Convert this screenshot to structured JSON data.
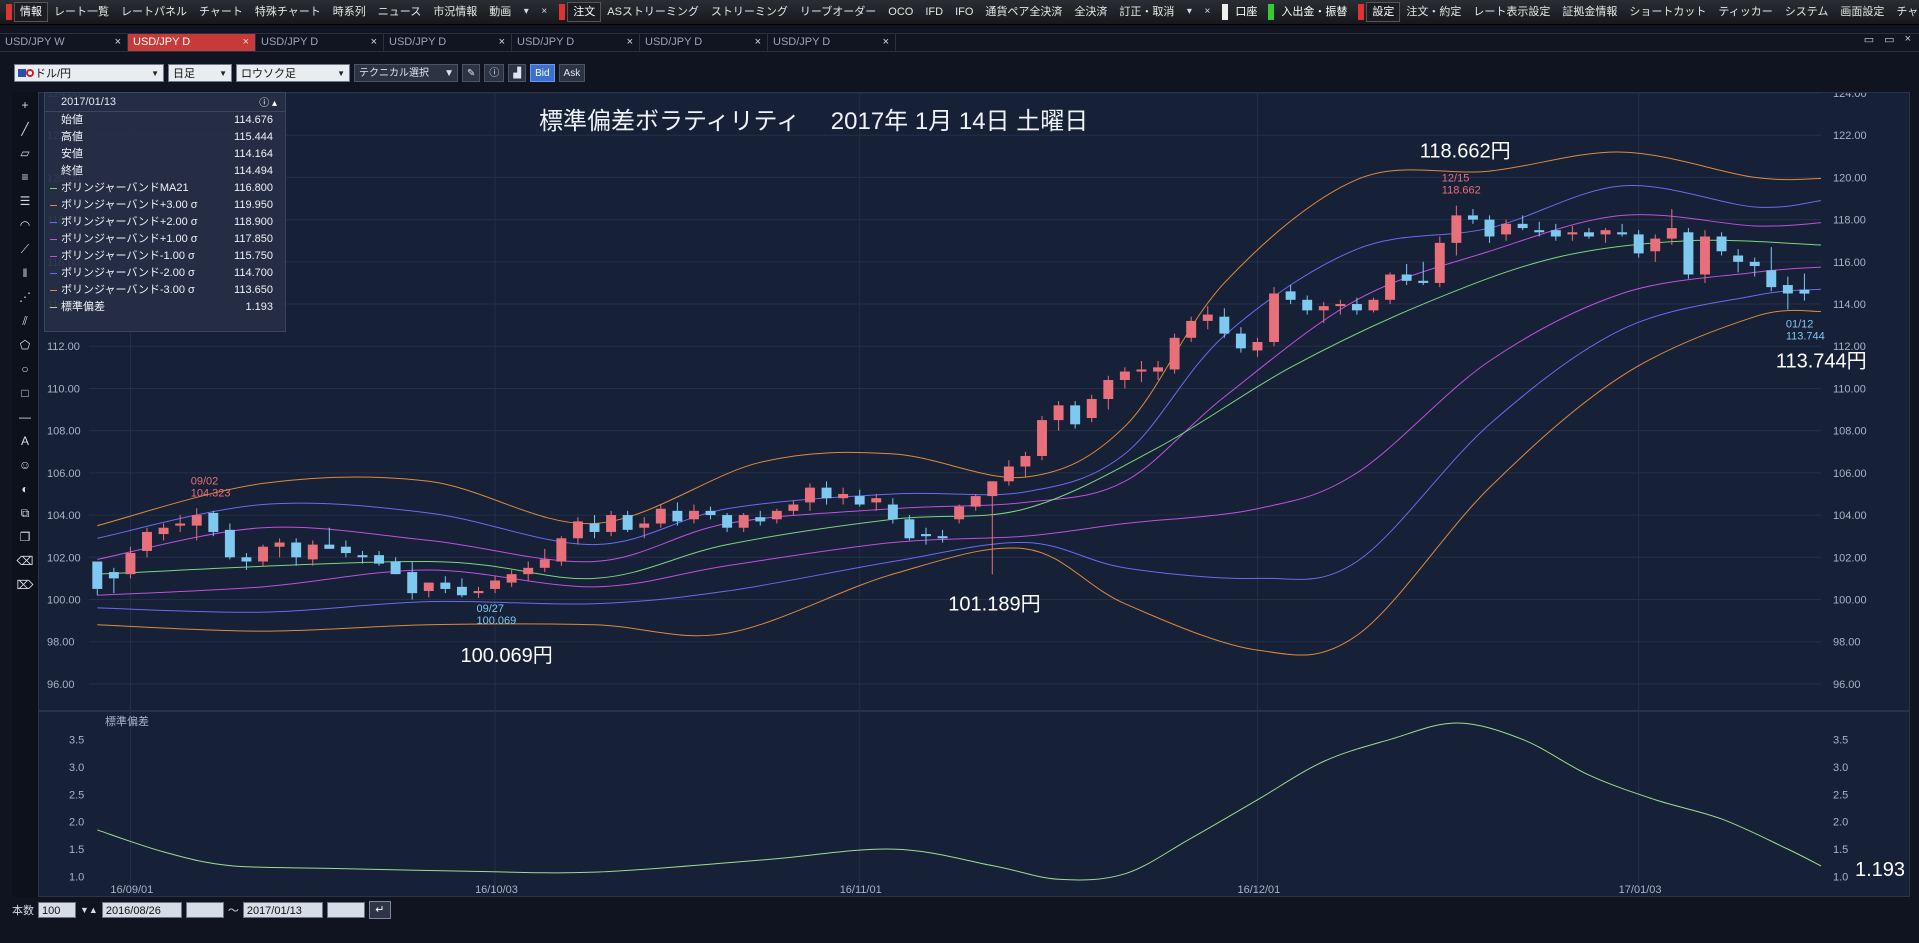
{
  "menubar": {
    "groups": [
      {
        "head": "情報",
        "items": [
          "レート一覧",
          "レートパネル",
          "チャート",
          "特殊チャート",
          "時系列",
          "ニュース",
          "市況情報",
          "動画"
        ],
        "extra": [
          "▾",
          "×"
        ]
      },
      {
        "head": "注文",
        "items": [
          "ASストリーミング",
          "ストリーミング",
          "リーブオーダー",
          "OCO",
          "IFD",
          "IFO",
          "通貨ペア全決済",
          "全決済",
          "訂正・取消"
        ],
        "extra": [
          "▾",
          "×"
        ]
      },
      {
        "head": "口座",
        "items": [],
        "extra": []
      },
      {
        "head": "入出金・振替",
        "items": [],
        "extra": []
      },
      {
        "head": "設定",
        "items": [
          "注文・約定",
          "レート表示設定",
          "証拠金情報",
          "ショートカット",
          "ティッカー",
          "システム",
          "画面設定",
          "チャート"
        ],
        "extra": [
          "▾",
          "×"
        ]
      }
    ]
  },
  "tabs": [
    {
      "label": "USD/JPY W",
      "active": false
    },
    {
      "label": "USD/JPY D",
      "active": true
    },
    {
      "label": "USD/JPY D",
      "active": false
    },
    {
      "label": "USD/JPY D",
      "active": false
    },
    {
      "label": "USD/JPY D",
      "active": false
    },
    {
      "label": "USD/JPY D",
      "active": false
    },
    {
      "label": "USD/JPY D",
      "active": false
    }
  ],
  "tab_close": "×",
  "window_controls": [
    "▭",
    "▭",
    "×"
  ],
  "toolbar": {
    "pair": "ドル/円",
    "timeframe": "日足",
    "chart_kind": "ロウソク足",
    "technical": "テクニカル選択",
    "bid": "Bid",
    "ask": "Ask"
  },
  "info_panel": {
    "date": "2017/01/13",
    "rows": [
      {
        "label": "始値",
        "value": "114.676",
        "color": ""
      },
      {
        "label": "高値",
        "value": "115.444",
        "color": ""
      },
      {
        "label": "安値",
        "value": "114.164",
        "color": ""
      },
      {
        "label": "終値",
        "value": "114.494",
        "color": ""
      },
      {
        "label": "ボリンジャーバンドMA21",
        "value": "116.800",
        "color": "#7bd67b"
      },
      {
        "label": "ボリンジャーバンド+3.00 σ",
        "value": "119.950",
        "color": "#e08a3c"
      },
      {
        "label": "ボリンジャーバンド+2.00 σ",
        "value": "118.900",
        "color": "#6b6bf0"
      },
      {
        "label": "ボリンジャーバンド+1.00 σ",
        "value": "117.850",
        "color": "#c050e0"
      },
      {
        "label": "ボリンジャーバンド-1.00 σ",
        "value": "115.750",
        "color": "#c050e0"
      },
      {
        "label": "ボリンジャーバンド-2.00 σ",
        "value": "114.700",
        "color": "#6b6bf0"
      },
      {
        "label": "ボリンジャーバンド-3.00 σ",
        "value": "113.650",
        "color": "#e08a3c"
      },
      {
        "label": "標準偏差",
        "value": "1.193",
        "color": "#9fdc8f"
      }
    ]
  },
  "chart": {
    "title": "標準偏差ボラティリティ　 2017年 1月 14日 土曜日",
    "price_ticks": [
      "124.00",
      "122.00",
      "120.00",
      "118.00",
      "116.00",
      "114.00",
      "112.00",
      "110.00",
      "108.00",
      "106.00",
      "104.00",
      "102.00",
      "100.00",
      "98.00",
      "96.00"
    ],
    "date_ticks": [
      "16/09/01",
      "16/10/03",
      "16/11/01",
      "16/12/01",
      "17/01/03"
    ],
    "sub_label": "標準偏差",
    "sub_ticks": [
      "3.5",
      "3.0",
      "2.5",
      "2.0",
      "1.5",
      "1.0"
    ],
    "annotations": {
      "high_big": "118.662円",
      "high_small_date": "12/15",
      "high_small_val": "118.662",
      "low_big": "113.744円",
      "low_small_date": "01/12",
      "low_small_val": "113.744",
      "sep_date": "09/02",
      "sep_val": "104.323",
      "sep27_date": "09/27",
      "sep27_val": "100.069",
      "sep27_big": "100.069円",
      "nov_big": "101.189円",
      "std_big": "1.193"
    }
  },
  "colors": {
    "up": "#e8707a",
    "down": "#7fc8f0",
    "ma": "#7bd67b",
    "sigma3": "#e08a3c",
    "sigma2": "#6b6bf0",
    "sigma1": "#c050e0",
    "std": "#9fdc8f"
  },
  "chart_data": {
    "type": "candlestick",
    "title": "標準偏差ボラティリティ　 2017年 1月 14日 土曜日",
    "ylim": [
      95,
      124
    ],
    "sub_ylim": [
      0.7,
      3.8
    ],
    "x_labels": [
      "16/09/01",
      "16/10/03",
      "16/11/01",
      "16/12/01",
      "17/01/03"
    ],
    "candles": [
      [
        101.8,
        101.5,
        100.2,
        100.5
      ],
      [
        101.3,
        101.5,
        100.3,
        101.0
      ],
      [
        101.2,
        102.5,
        101.0,
        102.2
      ],
      [
        102.3,
        103.4,
        102.0,
        103.2
      ],
      [
        103.1,
        103.6,
        102.8,
        103.4
      ],
      [
        103.5,
        104.0,
        103.2,
        103.6
      ],
      [
        103.5,
        104.323,
        102.8,
        104.0
      ],
      [
        104.1,
        104.2,
        103.0,
        103.2
      ],
      [
        103.3,
        103.6,
        101.9,
        102.0
      ],
      [
        102.0,
        102.2,
        101.4,
        101.8
      ],
      [
        101.8,
        102.6,
        101.6,
        102.5
      ],
      [
        102.5,
        102.9,
        102.0,
        102.7
      ],
      [
        102.7,
        102.9,
        101.6,
        102.0
      ],
      [
        101.9,
        102.8,
        101.6,
        102.6
      ],
      [
        102.6,
        103.4,
        102.4,
        102.4
      ],
      [
        102.5,
        102.8,
        102.0,
        102.2
      ],
      [
        102.1,
        102.3,
        101.7,
        102.0
      ],
      [
        102.1,
        102.3,
        101.6,
        101.7
      ],
      [
        101.8,
        102.0,
        101.2,
        101.2
      ],
      [
        101.3,
        101.8,
        100.0,
        100.3
      ],
      [
        100.4,
        100.8,
        100.1,
        100.8
      ],
      [
        100.8,
        101.1,
        100.3,
        100.5
      ],
      [
        100.6,
        101.0,
        100.1,
        100.2
      ],
      [
        100.3,
        100.6,
        100.069,
        100.4
      ],
      [
        100.5,
        101.1,
        100.3,
        100.9
      ],
      [
        100.8,
        101.4,
        100.6,
        101.2
      ],
      [
        101.2,
        101.8,
        100.9,
        101.5
      ],
      [
        101.5,
        102.4,
        101.3,
        101.9
      ],
      [
        101.8,
        103.0,
        101.6,
        102.9
      ],
      [
        102.9,
        103.9,
        102.6,
        103.7
      ],
      [
        103.6,
        104.0,
        102.9,
        103.2
      ],
      [
        103.2,
        104.2,
        103.0,
        104.0
      ],
      [
        104.0,
        104.2,
        103.2,
        103.3
      ],
      [
        103.4,
        103.9,
        102.9,
        103.6
      ],
      [
        103.6,
        104.5,
        103.4,
        104.3
      ],
      [
        104.2,
        104.6,
        103.5,
        103.7
      ],
      [
        103.8,
        104.5,
        103.6,
        104.2
      ],
      [
        104.2,
        104.4,
        103.8,
        104.0
      ],
      [
        104.0,
        104.1,
        103.2,
        103.4
      ],
      [
        103.4,
        104.1,
        103.2,
        104.0
      ],
      [
        103.9,
        104.2,
        103.5,
        103.7
      ],
      [
        103.8,
        104.3,
        103.6,
        104.2
      ],
      [
        104.2,
        104.7,
        104.0,
        104.5
      ],
      [
        104.6,
        105.5,
        104.2,
        105.3
      ],
      [
        105.3,
        105.6,
        104.5,
        104.8
      ],
      [
        104.8,
        105.3,
        104.5,
        105.0
      ],
      [
        104.9,
        105.2,
        104.4,
        104.5
      ],
      [
        104.6,
        105.0,
        104.2,
        104.8
      ],
      [
        104.5,
        104.8,
        103.6,
        103.8
      ],
      [
        103.8,
        104.0,
        102.8,
        102.9
      ],
      [
        103.1,
        103.4,
        102.6,
        103.0
      ],
      [
        103.0,
        103.3,
        102.7,
        102.9
      ],
      [
        103.8,
        104.5,
        103.6,
        104.4
      ],
      [
        104.4,
        105.0,
        104.2,
        104.9
      ],
      [
        104.9,
        105.6,
        101.189,
        105.6
      ],
      [
        105.6,
        106.6,
        105.4,
        106.3
      ],
      [
        106.3,
        107.0,
        105.8,
        106.8
      ],
      [
        106.8,
        108.7,
        106.6,
        108.5
      ],
      [
        108.5,
        109.4,
        108.0,
        109.2
      ],
      [
        109.2,
        109.4,
        108.1,
        108.3
      ],
      [
        108.6,
        109.7,
        108.4,
        109.5
      ],
      [
        109.5,
        110.6,
        109.0,
        110.4
      ],
      [
        110.4,
        111.0,
        110.0,
        110.8
      ],
      [
        110.8,
        111.3,
        110.3,
        110.9
      ],
      [
        110.8,
        111.3,
        110.4,
        111.0
      ],
      [
        110.9,
        112.6,
        110.7,
        112.4
      ],
      [
        112.4,
        113.4,
        112.2,
        113.2
      ],
      [
        113.2,
        113.9,
        112.8,
        113.5
      ],
      [
        113.4,
        113.8,
        112.4,
        112.6
      ],
      [
        112.6,
        112.9,
        111.7,
        111.9
      ],
      [
        111.8,
        112.4,
        111.5,
        112.2
      ],
      [
        112.2,
        114.8,
        112.0,
        114.5
      ],
      [
        114.6,
        114.9,
        114.0,
        114.2
      ],
      [
        114.2,
        114.4,
        113.5,
        113.7
      ],
      [
        113.7,
        114.1,
        113.1,
        113.9
      ],
      [
        113.9,
        114.2,
        113.5,
        114.0
      ],
      [
        114.0,
        114.3,
        113.5,
        113.7
      ],
      [
        113.7,
        114.3,
        113.6,
        114.2
      ],
      [
        114.2,
        115.5,
        114.0,
        115.4
      ],
      [
        115.4,
        115.9,
        114.9,
        115.1
      ],
      [
        115.1,
        116.0,
        114.9,
        115.0
      ],
      [
        115.0,
        117.2,
        114.8,
        116.9
      ],
      [
        116.9,
        118.662,
        116.3,
        118.2
      ],
      [
        118.2,
        118.5,
        117.8,
        118.0
      ],
      [
        118.0,
        118.2,
        116.9,
        117.2
      ],
      [
        117.3,
        118.0,
        117.0,
        117.8
      ],
      [
        117.8,
        118.2,
        117.5,
        117.6
      ],
      [
        117.5,
        117.9,
        117.2,
        117.4
      ],
      [
        117.5,
        117.8,
        117.0,
        117.2
      ],
      [
        117.3,
        117.7,
        117.0,
        117.4
      ],
      [
        117.4,
        117.6,
        117.1,
        117.2
      ],
      [
        117.3,
        117.6,
        116.9,
        117.5
      ],
      [
        117.4,
        117.8,
        117.2,
        117.3
      ],
      [
        117.3,
        117.5,
        116.2,
        116.4
      ],
      [
        116.5,
        117.3,
        116.0,
        117.1
      ],
      [
        117.1,
        118.5,
        116.8,
        117.6
      ],
      [
        117.4,
        117.6,
        115.2,
        115.4
      ],
      [
        115.4,
        117.5,
        115.0,
        117.2
      ],
      [
        117.2,
        117.4,
        116.3,
        116.5
      ],
      [
        116.3,
        116.6,
        115.5,
        116.0
      ],
      [
        116.0,
        116.2,
        115.3,
        115.8
      ],
      [
        115.6,
        116.7,
        114.6,
        114.8
      ],
      [
        114.9,
        115.3,
        113.744,
        114.5
      ],
      [
        114.676,
        115.444,
        114.164,
        114.494
      ]
    ],
    "bands": {
      "ma21": [
        [
          0,
          101.2
        ],
        [
          20,
          101.8
        ],
        [
          30,
          101.0
        ],
        [
          38,
          102.6
        ],
        [
          48,
          103.8
        ],
        [
          56,
          104.3
        ],
        [
          64,
          107.2
        ],
        [
          72,
          111.0
        ],
        [
          80,
          114.0
        ],
        [
          88,
          116.2
        ],
        [
          96,
          117.0
        ],
        [
          104,
          116.8
        ]
      ],
      "plus3": [
        [
          0,
          103.5
        ],
        [
          10,
          105.5
        ],
        [
          20,
          105.6
        ],
        [
          30,
          103.6
        ],
        [
          40,
          106.5
        ],
        [
          48,
          106.9
        ],
        [
          56,
          105.8
        ],
        [
          62,
          108.2
        ],
        [
          68,
          115.0
        ],
        [
          76,
          119.9
        ],
        [
          84,
          120.3
        ],
        [
          92,
          121.2
        ],
        [
          100,
          120.0
        ],
        [
          104,
          119.95
        ]
      ],
      "plus2": [
        [
          0,
          102.9
        ],
        [
          10,
          104.5
        ],
        [
          20,
          104.1
        ],
        [
          30,
          102.6
        ],
        [
          38,
          104.3
        ],
        [
          48,
          105.0
        ],
        [
          56,
          105.1
        ],
        [
          62,
          106.9
        ],
        [
          68,
          112.5
        ],
        [
          76,
          116.6
        ],
        [
          84,
          117.6
        ],
        [
          92,
          119.6
        ],
        [
          100,
          118.6
        ],
        [
          104,
          118.9
        ]
      ],
      "plus1": [
        [
          0,
          101.9
        ],
        [
          10,
          103.4
        ],
        [
          20,
          102.8
        ],
        [
          30,
          101.8
        ],
        [
          38,
          103.6
        ],
        [
          48,
          104.3
        ],
        [
          56,
          104.6
        ],
        [
          62,
          105.6
        ],
        [
          68,
          109.6
        ],
        [
          76,
          114.2
        ],
        [
          84,
          116.5
        ],
        [
          92,
          118.2
        ],
        [
          100,
          117.7
        ],
        [
          104,
          117.85
        ]
      ],
      "minus1": [
        [
          0,
          100.2
        ],
        [
          10,
          100.6
        ],
        [
          20,
          101.4
        ],
        [
          30,
          100.6
        ],
        [
          38,
          101.6
        ],
        [
          48,
          102.7
        ],
        [
          56,
          103.0
        ],
        [
          62,
          103.6
        ],
        [
          70,
          104.3
        ],
        [
          76,
          106.0
        ],
        [
          84,
          111.3
        ],
        [
          92,
          114.5
        ],
        [
          100,
          115.5
        ],
        [
          104,
          115.75
        ]
      ],
      "minus2": [
        [
          0,
          99.6
        ],
        [
          10,
          99.4
        ],
        [
          20,
          99.9
        ],
        [
          30,
          99.8
        ],
        [
          38,
          100.4
        ],
        [
          48,
          101.8
        ],
        [
          56,
          102.7
        ],
        [
          62,
          101.5
        ],
        [
          70,
          101.0
        ],
        [
          76,
          101.8
        ],
        [
          84,
          108.3
        ],
        [
          92,
          112.8
        ],
        [
          100,
          114.4
        ],
        [
          104,
          114.7
        ]
      ],
      "minus3": [
        [
          0,
          98.8
        ],
        [
          10,
          98.5
        ],
        [
          20,
          98.8
        ],
        [
          30,
          98.8
        ],
        [
          38,
          98.4
        ],
        [
          48,
          101.2
        ],
        [
          56,
          102.4
        ],
        [
          62,
          99.8
        ],
        [
          70,
          97.6
        ],
        [
          76,
          98.3
        ],
        [
          84,
          105.3
        ],
        [
          92,
          110.6
        ],
        [
          100,
          113.4
        ],
        [
          104,
          113.65
        ]
      ]
    },
    "std": [
      [
        0,
        1.85
      ],
      [
        4,
        1.45
      ],
      [
        8,
        1.2
      ],
      [
        14,
        1.15
      ],
      [
        22,
        1.1
      ],
      [
        30,
        1.08
      ],
      [
        40,
        1.3
      ],
      [
        48,
        1.5
      ],
      [
        54,
        1.2
      ],
      [
        58,
        0.95
      ],
      [
        62,
        1.05
      ],
      [
        66,
        1.7
      ],
      [
        70,
        2.4
      ],
      [
        74,
        3.1
      ],
      [
        78,
        3.5
      ],
      [
        82,
        3.8
      ],
      [
        86,
        3.5
      ],
      [
        90,
        2.85
      ],
      [
        94,
        2.4
      ],
      [
        98,
        2.05
      ],
      [
        102,
        1.5
      ],
      [
        104,
        1.193
      ]
    ]
  }
}
